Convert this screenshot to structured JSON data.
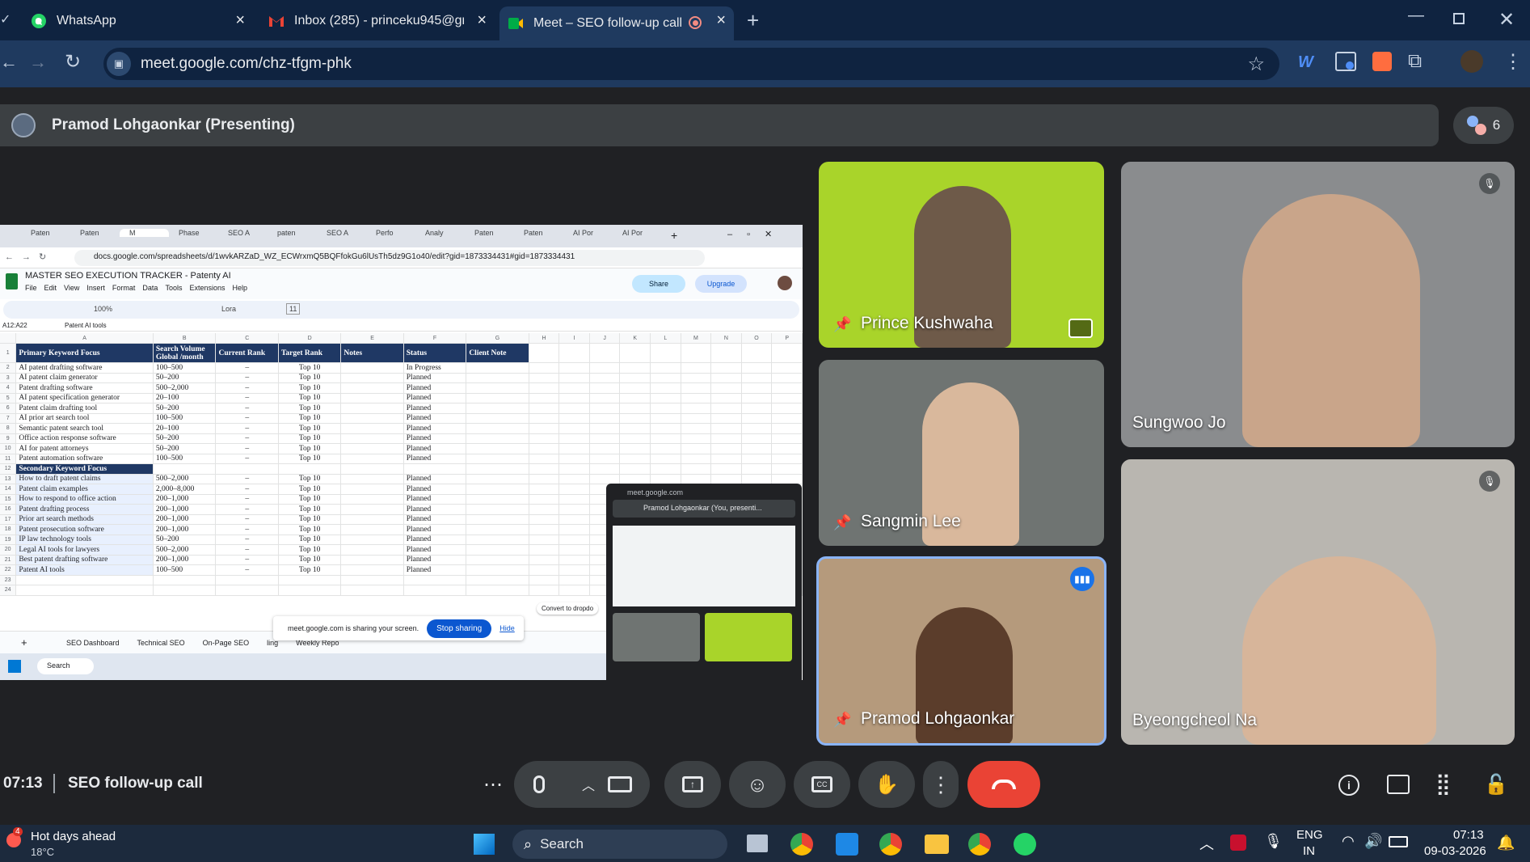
{
  "browser": {
    "tabs": [
      {
        "label": "WhatsApp",
        "icon": "whatsapp-icon"
      },
      {
        "label": "Inbox (285) - princeku945@gm",
        "icon": "gmail-icon"
      },
      {
        "label": "Meet – SEO follow-up call",
        "icon": "meet-icon"
      }
    ],
    "url": "meet.google.com/chz-tfgm-phk"
  },
  "presenting_bar": {
    "label": "Pramod Lohgaonkar (Presenting)",
    "participant_count": "6"
  },
  "shared_screen": {
    "inner_tabs": [
      "Paten",
      "Paten",
      "M",
      "Phase",
      "SEO A",
      "paten",
      "SEO A",
      "Perfo",
      "Analy",
      "Paten",
      "Paten",
      "AI Por",
      "AI Por"
    ],
    "inner_url": "docs.google.com/spreadsheets/d/1wvkARZaD_WZ_ECWrxmQ5BQFfokGu6lUsTh5dz9G1o40/edit?gid=1873334431#gid=1873334431",
    "doc_title": "MASTER SEO EXECUTION TRACKER - Patenty AI",
    "menu": [
      "File",
      "Edit",
      "View",
      "Insert",
      "Format",
      "Data",
      "Tools",
      "Extensions",
      "Help"
    ],
    "share_label": "Share",
    "upgrade_label": "Upgrade",
    "zoom": "100%",
    "font": "Lora",
    "font_size": "11",
    "cell_ref": "A12:A22",
    "formula": "Patent AI tools",
    "col_letters": [
      "A",
      "B",
      "C",
      "D",
      "E",
      "F",
      "G",
      "H",
      "I",
      "J",
      "K",
      "L",
      "M",
      "N",
      "O",
      "P"
    ],
    "headers": [
      "Primary Keyword Focus",
      "Search Volume Global /month",
      "Current Rank",
      "Target Rank",
      "Notes",
      "Status",
      "Client Note"
    ],
    "rows": [
      [
        "2",
        "AI patent drafting software",
        "100–500",
        "–",
        "Top 10",
        "",
        "In Progress"
      ],
      [
        "3",
        "AI patent claim generator",
        "50–200",
        "–",
        "Top 10",
        "",
        "Planned"
      ],
      [
        "4",
        "Patent drafting software",
        "500–2,000",
        "–",
        "Top 10",
        "",
        "Planned"
      ],
      [
        "5",
        "AI patent specification generator",
        "20–100",
        "–",
        "Top 10",
        "",
        "Planned"
      ],
      [
        "6",
        "Patent claim drafting tool",
        "50–200",
        "–",
        "Top 10",
        "",
        "Planned"
      ],
      [
        "7",
        "AI prior art search tool",
        "100–500",
        "–",
        "Top 10",
        "",
        "Planned"
      ],
      [
        "8",
        "Semantic patent search tool",
        "20–100",
        "–",
        "Top 10",
        "",
        "Planned"
      ],
      [
        "9",
        "Office action response software",
        "50–200",
        "–",
        "Top 10",
        "",
        "Planned"
      ],
      [
        "10",
        "AI for patent attorneys",
        "50–200",
        "–",
        "Top 10",
        "",
        "Planned"
      ],
      [
        "11",
        "Patent automation software",
        "100–500",
        "–",
        "Top 10",
        "",
        "Planned"
      ],
      [
        "12",
        "Secondary Keyword Focus",
        "",
        "",
        "",
        "",
        ""
      ],
      [
        "13",
        "How to draft patent claims",
        "500–2,000",
        "–",
        "Top 10",
        "",
        "Planned"
      ],
      [
        "14",
        "Patent claim examples",
        "2,000–8,000",
        "–",
        "Top 10",
        "",
        "Planned"
      ],
      [
        "15",
        "How to respond to office action",
        "200–1,000",
        "–",
        "Top 10",
        "",
        "Planned"
      ],
      [
        "16",
        "Patent drafting process",
        "200–1,000",
        "–",
        "Top 10",
        "",
        "Planned"
      ],
      [
        "17",
        "Prior art search methods",
        "200–1,000",
        "–",
        "Top 10",
        "",
        "Planned"
      ],
      [
        "18",
        "Patent prosecution software",
        "200–1,000",
        "–",
        "Top 10",
        "",
        "Planned"
      ],
      [
        "19",
        "IP law technology tools",
        "50–200",
        "–",
        "Top 10",
        "",
        "Planned"
      ],
      [
        "20",
        "Legal AI tools for lawyers",
        "500–2,000",
        "–",
        "Top 10",
        "",
        "Planned"
      ],
      [
        "21",
        "Best patent drafting software",
        "200–1,000",
        "–",
        "Top 10",
        "",
        "Planned"
      ],
      [
        "22",
        "Patent AI tools",
        "100–500",
        "–",
        "Top 10",
        "",
        "Planned"
      ],
      [
        "23",
        "",
        "",
        "",
        "",
        "",
        ""
      ],
      [
        "24",
        "",
        "",
        "",
        "",
        "",
        ""
      ]
    ],
    "sheet_tabs": [
      "SEO Dashboard",
      "Technical SEO",
      "On-Page SEO",
      "ling",
      "Weekly Repo"
    ],
    "sharing_msg": "meet.google.com is sharing your screen.",
    "stop_sharing": "Stop sharing",
    "hide": "Hide",
    "convert_label": "Convert to dropdo",
    "pip_title": "meet.google.com",
    "pip_presenter": "Pramod Lohgaonkar (You, presenti...",
    "inner_search": "Search"
  },
  "participants": [
    {
      "name": "Prince Kushwaha",
      "bg": "#a9d42a"
    },
    {
      "name": "Sungwoo Jo",
      "bg": "#8a8c8e"
    },
    {
      "name": "Sangmin Lee",
      "bg": "#6f7472"
    },
    {
      "name": "Pramod Lohgaonkar",
      "bg": "#b59a7c"
    },
    {
      "name": "Byeongcheol Na",
      "bg": "#b9b6b0"
    }
  ],
  "bottom": {
    "time": "07:13",
    "meeting_title": "SEO follow-up call"
  },
  "taskbar": {
    "weather_title": "Hot days ahead",
    "weather_temp": "18°C",
    "weather_badge": "4",
    "search": "Search",
    "lang": "ENG",
    "region": "IN",
    "time": "07:13",
    "date": "09-03-2026"
  },
  "colors": {
    "accent_blue": "#0b57d0",
    "end_call_red": "#ea4335",
    "header_navy": "#1f3864"
  }
}
